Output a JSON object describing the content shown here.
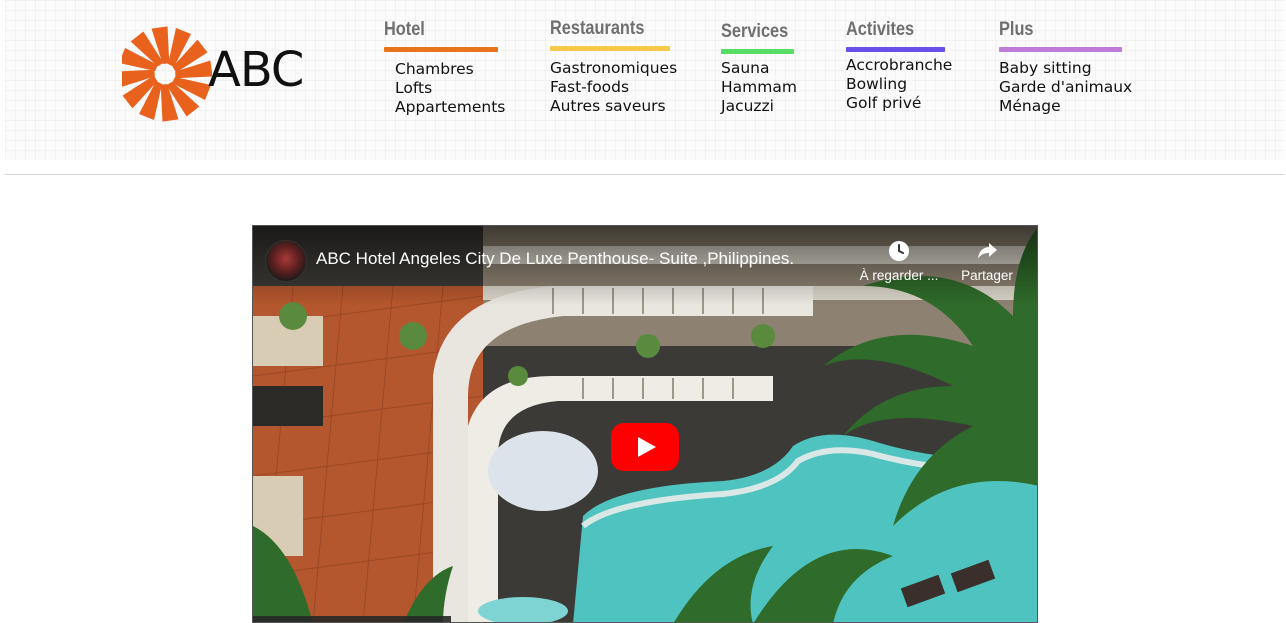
{
  "logo": {
    "text": "ABC",
    "icon": "sunburst-logo-icon",
    "color": "#e8621e"
  },
  "menu": [
    {
      "title": "Hotel",
      "color": "#e8731a",
      "items": [
        "Chambres",
        "Lofts",
        "Appartements"
      ]
    },
    {
      "title": "Restaurants",
      "color": "#f6c94a",
      "items": [
        "Gastronomiques",
        "Fast-foods",
        "Autres saveurs"
      ]
    },
    {
      "title": "Services",
      "color": "#55dd66",
      "items": [
        "Sauna",
        "Hammam",
        "Jacuzzi"
      ]
    },
    {
      "title": "Activites",
      "color": "#6a4ee8",
      "items": [
        "Accrobranche",
        "Bowling",
        "Golf privé"
      ]
    },
    {
      "title": "Plus",
      "color": "#c07ad8",
      "items": [
        "Baby sitting",
        "Garde d'animaux",
        "Ménage"
      ]
    }
  ],
  "video": {
    "title": "ABC Hotel Angeles City De Luxe Penthouse- Suite ,Philippines.",
    "watch_later_label": "À regarder ...",
    "share_label": "Partager",
    "play_icon": "play-icon",
    "brand_color": "#ff0000"
  }
}
